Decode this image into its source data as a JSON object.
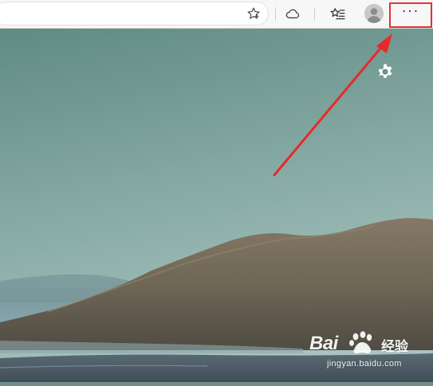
{
  "toolbar": {
    "favorite_icon": "star-outline-icon",
    "collections_icon": "cloud-icon",
    "favorites_icon": "favorites-star-list-icon",
    "profile_icon": "avatar-icon",
    "more_label": "···"
  },
  "newtab": {
    "settings_icon": "gear-icon"
  },
  "annotation": {
    "arrow_color": "#e62a2a",
    "highlight_color": "#e23333"
  },
  "watermark": {
    "brand": "Bai",
    "brand_suffix": "经验",
    "url": "jingyan.baidu.com"
  }
}
